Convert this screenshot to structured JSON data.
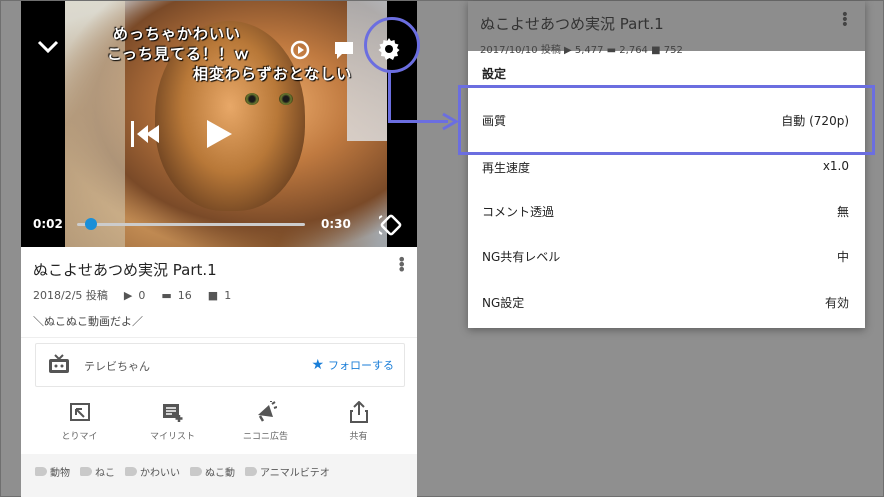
{
  "player": {
    "comments": [
      "めっちゃかわいい",
      "こっち見てる！！ｗ",
      "相変わらずおとなしい"
    ],
    "current_time": "0:02",
    "duration": "0:30",
    "progress": 0.07
  },
  "video": {
    "title": "ぬこよせあつめ実況 Part.1",
    "posted": "2018/2/5 投稿",
    "views": "0",
    "comments": "16",
    "mylists": "1",
    "description": "＼ぬこぬこ動画だよ／"
  },
  "channel": {
    "name": "テレビちゃん",
    "follow_label": "フォローする"
  },
  "actions": [
    {
      "label": "とりマイ",
      "icon": "tori-my-icon"
    },
    {
      "label": "マイリスト",
      "icon": "mylist-icon"
    },
    {
      "label": "ニコニ広告",
      "icon": "nicoad-icon"
    },
    {
      "label": "共有",
      "icon": "share-icon"
    }
  ],
  "tags": [
    "動物",
    "ねこ",
    "かわいい",
    "ぬこ動",
    "アニマルビテオ"
  ],
  "settings_panel": {
    "bg_title": "ぬこよせあつめ実況 Part.1",
    "bg_sub": "2017/10/10 投稿  ▶ 5,477  ▬ 2,764  ■ 752",
    "heading": "設定",
    "rows": [
      {
        "label": "画質",
        "value": "自動 (720p)"
      },
      {
        "label": "再生速度",
        "value": "x1.0"
      },
      {
        "label": "コメント透過",
        "value": "無"
      },
      {
        "label": "NG共有レベル",
        "value": "中"
      },
      {
        "label": "NG設定",
        "value": "有効"
      }
    ]
  },
  "colors": {
    "highlight": "#6b6ee0",
    "accent_blue": "#1a7ed8",
    "seek_knob": "#1a8fd8"
  }
}
